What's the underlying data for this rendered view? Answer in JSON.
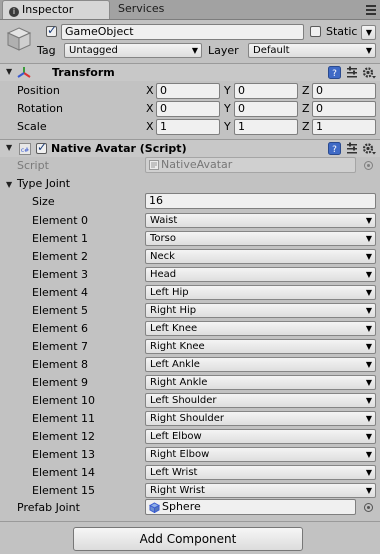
{
  "tabs": [
    {
      "label": "Inspector",
      "icon": "info-icon",
      "active": true
    },
    {
      "label": "Services",
      "active": false
    }
  ],
  "gameobject": {
    "active": true,
    "name": "GameObject",
    "static_label": "Static",
    "static": false,
    "tag_label": "Tag",
    "tag_value": "Untagged",
    "layer_label": "Layer",
    "layer_value": "Default"
  },
  "transform": {
    "title": "Transform",
    "rows": [
      {
        "label": "Position",
        "x": "0",
        "y": "0",
        "z": "0"
      },
      {
        "label": "Rotation",
        "x": "0",
        "y": "0",
        "z": "0"
      },
      {
        "label": "Scale",
        "x": "1",
        "y": "1",
        "z": "1"
      }
    ],
    "axis_labels": [
      "X",
      "Y",
      "Z"
    ]
  },
  "native_avatar": {
    "enabled": true,
    "title": "Native Avatar (Script)",
    "script_label": "Script",
    "script_value": "NativeAvatar",
    "type_joint_label": "Type Joint",
    "size_label": "Size",
    "size_value": "16",
    "elements": [
      {
        "label": "Element 0",
        "value": "Waist"
      },
      {
        "label": "Element 1",
        "value": "Torso"
      },
      {
        "label": "Element 2",
        "value": "Neck"
      },
      {
        "label": "Element 3",
        "value": "Head"
      },
      {
        "label": "Element 4",
        "value": "Left Hip"
      },
      {
        "label": "Element 5",
        "value": "Right Hip"
      },
      {
        "label": "Element 6",
        "value": "Left Knee"
      },
      {
        "label": "Element 7",
        "value": "Right Knee"
      },
      {
        "label": "Element 8",
        "value": "Left Ankle"
      },
      {
        "label": "Element 9",
        "value": "Right Ankle"
      },
      {
        "label": "Element 10",
        "value": "Left Shoulder"
      },
      {
        "label": "Element 11",
        "value": "Right Shoulder"
      },
      {
        "label": "Element 12",
        "value": "Left Elbow"
      },
      {
        "label": "Element 13",
        "value": "Right Elbow"
      },
      {
        "label": "Element 14",
        "value": "Left Wrist"
      },
      {
        "label": "Element 15",
        "value": "Right Wrist"
      }
    ],
    "prefab_label": "Prefab Joint",
    "prefab_value": "Sphere"
  },
  "add_component_label": "Add Component",
  "colors": {
    "panel_bg": "#c2c2c2",
    "tab_bar": "#a2a2a2",
    "field_bg": "#f0f0f0",
    "help_icon_blue": "#3f6ac6"
  }
}
